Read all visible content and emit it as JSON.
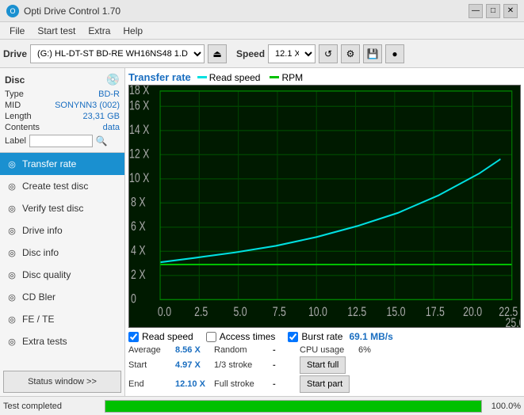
{
  "titleBar": {
    "title": "Opti Drive Control 1.70",
    "minimizeBtn": "—",
    "maximizeBtn": "□",
    "closeBtn": "✕"
  },
  "menuBar": {
    "items": [
      "File",
      "Start test",
      "Extra",
      "Help"
    ]
  },
  "toolbar": {
    "driveLabel": "Drive",
    "driveValue": "(G:)  HL-DT-ST BD-RE  WH16NS48 1.D3",
    "speedLabel": "Speed",
    "speedValue": "12.1 X"
  },
  "discPanel": {
    "title": "Disc",
    "rows": [
      {
        "label": "Type",
        "value": "BD-R"
      },
      {
        "label": "MID",
        "value": "SONYNN3 (002)"
      },
      {
        "label": "Length",
        "value": "23,31 GB"
      },
      {
        "label": "Contents",
        "value": "data"
      },
      {
        "label": "Label",
        "value": ""
      }
    ]
  },
  "navItems": [
    {
      "label": "Transfer rate",
      "active": true,
      "icon": "◎"
    },
    {
      "label": "Create test disc",
      "active": false,
      "icon": "◎"
    },
    {
      "label": "Verify test disc",
      "active": false,
      "icon": "◎"
    },
    {
      "label": "Drive info",
      "active": false,
      "icon": "◎"
    },
    {
      "label": "Disc info",
      "active": false,
      "icon": "◎"
    },
    {
      "label": "Disc quality",
      "active": false,
      "icon": "◎"
    },
    {
      "label": "CD Bler",
      "active": false,
      "icon": "◎"
    },
    {
      "label": "FE / TE",
      "active": false,
      "icon": "◎"
    },
    {
      "label": "Extra tests",
      "active": false,
      "icon": "◎"
    }
  ],
  "statusBtn": "Status window >>",
  "chart": {
    "title": "Transfer rate",
    "legend": [
      {
        "label": "Read speed",
        "color": "#00e0e0"
      },
      {
        "label": "RPM",
        "color": "#00c000"
      }
    ],
    "yAxisMax": 18,
    "xAxisMax": 25,
    "gridColor": "#005500",
    "bgColor": "#001a00"
  },
  "checkboxes": [
    {
      "label": "Read speed",
      "checked": true
    },
    {
      "label": "Access times",
      "checked": false
    },
    {
      "label": "Burst rate",
      "checked": true,
      "extraValue": "69.1 MB/s"
    }
  ],
  "stats": {
    "rows": [
      {
        "col1": {
          "label": "Average",
          "value": "8.56 X"
        },
        "col2": {
          "label": "Random",
          "value": "-"
        },
        "col3": {
          "label": "CPU usage",
          "value": "6%"
        }
      },
      {
        "col1": {
          "label": "Start",
          "value": "4.97 X"
        },
        "col2": {
          "label": "1/3 stroke",
          "value": "-"
        },
        "col3": {
          "label": "",
          "value": "",
          "btnLabel": "Start full"
        }
      },
      {
        "col1": {
          "label": "End",
          "value": "12.10 X"
        },
        "col2": {
          "label": "Full stroke",
          "value": "-"
        },
        "col3": {
          "label": "",
          "value": "",
          "btnLabel": "Start part"
        }
      }
    ]
  },
  "statusBar": {
    "text": "Test completed",
    "progress": 100,
    "progressText": "100.0%"
  }
}
